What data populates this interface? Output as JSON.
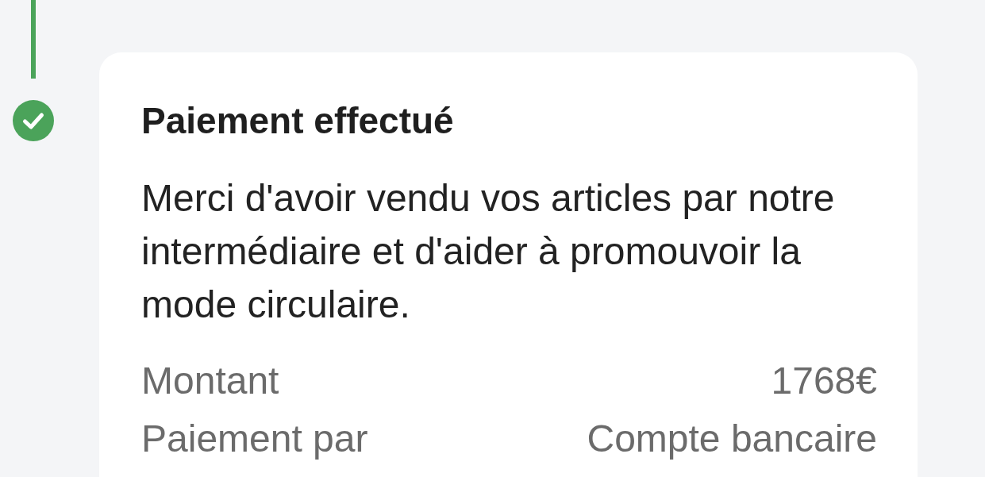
{
  "step": {
    "completed": true
  },
  "card": {
    "title": "Paiement effectué",
    "message": "Merci d'avoir vendu vos articles par notre intermédiaire et d'aider à promouvoir la mode circulaire.",
    "details": [
      {
        "label": "Montant",
        "value": "1768€"
      },
      {
        "label": "Paiement par",
        "value": "Compte bancaire"
      }
    ]
  }
}
